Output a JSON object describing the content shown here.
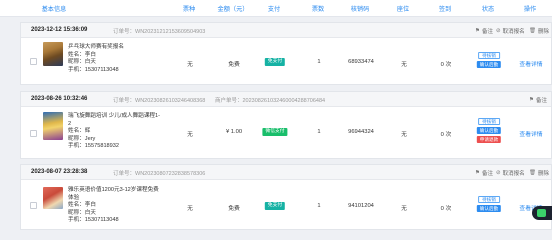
{
  "columns": [
    "基本信息",
    "票种",
    "金额（元）",
    "支付",
    "票数",
    "核销码",
    "座位",
    "签到",
    "状态",
    "操作"
  ],
  "header_actions": {
    "note": "备注",
    "cancel": "取消报名",
    "delete": "删除"
  },
  "orders": [
    {
      "time": "2023-12-12 15:36:09",
      "order_no": "订单号：WN20231212153609504903",
      "merchant_no": "",
      "title": "乒乓球大师赛有奖报名",
      "name": "姓名：李白",
      "nickname": "昵称：白天",
      "phone": "手机：15307113048",
      "ticket_type": "无",
      "amount": "免费",
      "pay": "免支付",
      "pay_color": "#16b2a4",
      "qty": "1",
      "code": "68933474",
      "seat": "无",
      "checkin": "0 次",
      "status_buttons": [
        "待核销",
        "确认后勤"
      ],
      "action": "查看详情"
    },
    {
      "time": "2023-08-26 10:32:46",
      "order_no": "订单号：WN20230826103246408368",
      "merchant_no": "商户单号：202308261032460004288706484",
      "title": "瑞飞旋舞蹈培训 少儿/成人舞蹈课程1-2",
      "name": "姓名：辉",
      "nickname": "昵称：Jery",
      "phone": "手机：15575818932",
      "ticket_type": "无",
      "amount": "¥ 1.00",
      "pay": "微信支付",
      "pay_color": "#19be6b",
      "qty": "1",
      "code": "96944324",
      "seat": "无",
      "checkin": "0 次",
      "status_buttons": [
        "待核销",
        "确认后勤",
        "申请退款"
      ],
      "action": "查看详情"
    },
    {
      "time": "2023-08-07 23:28:38",
      "order_no": "订单号：WN20230807232838578306",
      "merchant_no": "",
      "title": "雅乐英语价值1200元3-12岁课程免费体验",
      "name": "姓名：李白",
      "nickname": "昵称：白天",
      "phone": "手机：15307113048",
      "ticket_type": "无",
      "amount": "免费",
      "pay": "免支付",
      "pay_color": "#16b2a4",
      "qty": "1",
      "code": "94101204",
      "seat": "无",
      "checkin": "0 次",
      "status_buttons": [
        "待核销",
        "确认后勤"
      ],
      "action": "查看详情"
    }
  ]
}
